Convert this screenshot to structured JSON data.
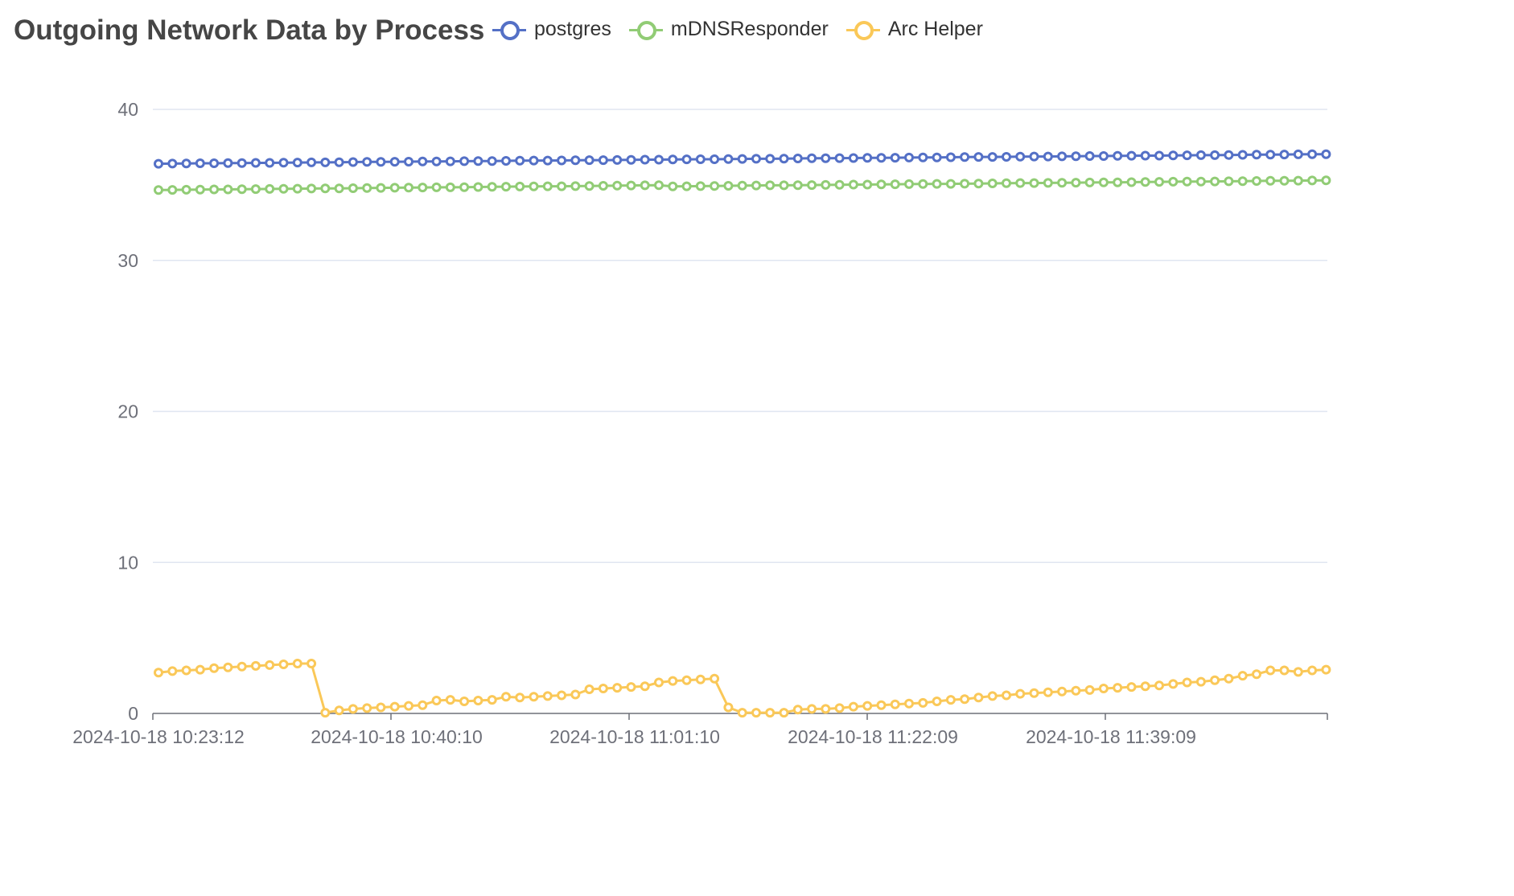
{
  "chart_data": {
    "type": "line",
    "title": "Outgoing Network Data by Process",
    "xlabel": "",
    "ylabel": "",
    "ylim": [
      0,
      40
    ],
    "yticks": [
      0,
      10,
      20,
      30,
      40
    ],
    "x_tick_labels": [
      {
        "index": 0,
        "label": "2024-10-18 10:23:12"
      },
      {
        "index": 17,
        "label": "2024-10-18 10:40:10"
      },
      {
        "index": 34,
        "label": "2024-10-18 11:01:10"
      },
      {
        "index": 51,
        "label": "2024-10-18 11:22:09"
      },
      {
        "index": 68,
        "label": "2024-10-18 11:39:09"
      }
    ],
    "grid": true,
    "legend_position": "top",
    "series": [
      {
        "name": "postgres",
        "color": "#5470c6",
        "values": [
          36.4,
          36.41,
          36.42,
          36.43,
          36.43,
          36.44,
          36.45,
          36.46,
          36.46,
          36.47,
          36.48,
          36.49,
          36.49,
          36.5,
          36.51,
          36.52,
          36.52,
          36.53,
          36.54,
          36.55,
          36.55,
          36.56,
          36.57,
          36.58,
          36.58,
          36.59,
          36.6,
          36.61,
          36.61,
          36.62,
          36.63,
          36.64,
          36.64,
          36.65,
          36.66,
          36.67,
          36.67,
          36.68,
          36.69,
          36.7,
          36.7,
          36.71,
          36.72,
          36.73,
          36.73,
          36.74,
          36.75,
          36.76,
          36.76,
          36.77,
          36.78,
          36.79,
          36.79,
          36.8,
          36.81,
          36.82,
          36.82,
          36.83,
          36.84,
          36.85,
          36.85,
          36.86,
          36.87,
          36.88,
          36.88,
          36.89,
          36.9,
          36.91,
          36.91,
          36.92,
          36.93,
          36.94,
          36.94,
          36.95,
          36.96,
          36.97,
          36.97,
          36.98,
          36.99,
          37.0,
          37.0,
          37.01,
          37.02,
          37.03,
          37.03
        ]
      },
      {
        "name": "mDNSResponder",
        "color": "#91cc75",
        "values": [
          34.66,
          34.67,
          34.68,
          34.69,
          34.7,
          34.7,
          34.71,
          34.72,
          34.73,
          34.74,
          34.75,
          34.76,
          34.77,
          34.77,
          34.78,
          34.79,
          34.8,
          34.81,
          34.82,
          34.83,
          34.84,
          34.84,
          34.85,
          34.86,
          34.87,
          34.88,
          34.89,
          34.9,
          34.91,
          34.91,
          34.92,
          34.93,
          34.94,
          34.95,
          34.96,
          34.97,
          34.98,
          34.9,
          34.91,
          34.92,
          34.93,
          34.94,
          34.95,
          34.96,
          34.97,
          34.97,
          34.98,
          34.99,
          35.0,
          35.01,
          35.02,
          35.02,
          35.03,
          35.04,
          35.05,
          35.06,
          35.07,
          35.07,
          35.08,
          35.09,
          35.1,
          35.11,
          35.12,
          35.12,
          35.13,
          35.14,
          35.15,
          35.16,
          35.17,
          35.17,
          35.18,
          35.19,
          35.2,
          35.21,
          35.22,
          35.22,
          35.23,
          35.24,
          35.25,
          35.26,
          35.27,
          35.27,
          35.28,
          35.29,
          35.3
        ]
      },
      {
        "name": "Arc Helper",
        "color": "#fac858",
        "values": [
          2.7,
          2.8,
          2.85,
          2.9,
          3.0,
          3.05,
          3.1,
          3.15,
          3.2,
          3.25,
          3.3,
          3.3,
          0.05,
          0.2,
          0.3,
          0.35,
          0.4,
          0.45,
          0.5,
          0.55,
          0.85,
          0.9,
          0.8,
          0.85,
          0.9,
          1.1,
          1.05,
          1.1,
          1.15,
          1.2,
          1.25,
          1.6,
          1.65,
          1.7,
          1.75,
          1.8,
          2.05,
          2.15,
          2.2,
          2.25,
          2.3,
          0.4,
          0.05,
          0.05,
          0.05,
          0.05,
          0.25,
          0.3,
          0.3,
          0.35,
          0.45,
          0.5,
          0.55,
          0.6,
          0.65,
          0.7,
          0.8,
          0.9,
          0.95,
          1.05,
          1.15,
          1.2,
          1.3,
          1.35,
          1.4,
          1.45,
          1.5,
          1.55,
          1.65,
          1.7,
          1.75,
          1.8,
          1.85,
          1.95,
          2.05,
          2.1,
          2.2,
          2.3,
          2.5,
          2.6,
          2.85,
          2.85,
          2.75,
          2.85,
          2.9
        ]
      }
    ]
  }
}
